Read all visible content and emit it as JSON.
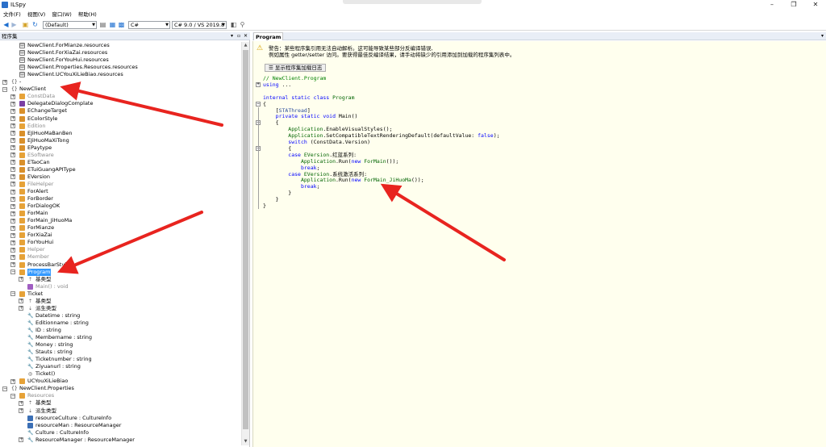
{
  "window": {
    "title": "ILSpy",
    "minimize": "–",
    "maximize": "❐",
    "close": "✕"
  },
  "menu": [
    "文件(F)",
    "视图(V)",
    "窗口(W)",
    "帮助(H)"
  ],
  "toolbar": {
    "assembly_list": "(Default)",
    "language": "C#",
    "language_version": "C# 9.0 / VS 2019.8"
  },
  "left_panel": {
    "title": "程序集",
    "pin": "▾",
    "close": "✕",
    "hide": "▫"
  },
  "tree": [
    {
      "label": "NewClient.ForMianze.resources",
      "indent": 1,
      "icon": "resource-file-icon",
      "exp": ""
    },
    {
      "label": "NewClient.ForXiaZai.resources",
      "indent": 1,
      "icon": "resource-file-icon",
      "exp": ""
    },
    {
      "label": "NewClient.ForYouHui.resources",
      "indent": 1,
      "icon": "resource-file-icon",
      "exp": ""
    },
    {
      "label": "NewClient.Properties.Resources.resources",
      "indent": 1,
      "icon": "resource-file-icon",
      "exp": ""
    },
    {
      "label": "NewClient.UCYouXiLieBiao.resources",
      "indent": 1,
      "icon": "resource-file-icon",
      "exp": ""
    },
    {
      "label": "-",
      "indent": 0,
      "icon": "namespace-icon",
      "exp": "+"
    },
    {
      "label": "NewClient",
      "indent": 0,
      "icon": "namespace-icon",
      "exp": "−"
    },
    {
      "label": "ConstData",
      "indent": 1,
      "icon": "class-icon",
      "exp": "+",
      "dim": true
    },
    {
      "label": "DelegateDialogComplate",
      "indent": 1,
      "icon": "delegate-icon",
      "exp": "+"
    },
    {
      "label": "EChangeTarget",
      "indent": 1,
      "icon": "enum-icon",
      "exp": "+"
    },
    {
      "label": "EColorStyle",
      "indent": 1,
      "icon": "enum-icon",
      "exp": "+"
    },
    {
      "label": "Edition",
      "indent": 1,
      "icon": "class-icon",
      "exp": "+",
      "dim": true
    },
    {
      "label": "EJiHuoMaBanBen",
      "indent": 1,
      "icon": "enum-icon",
      "exp": "+"
    },
    {
      "label": "EJiHuoMaXiTong",
      "indent": 1,
      "icon": "enum-icon",
      "exp": "+"
    },
    {
      "label": "EPaytype",
      "indent": 1,
      "icon": "enum-icon",
      "exp": "+"
    },
    {
      "label": "ESoftware",
      "indent": 1,
      "icon": "class-icon",
      "exp": "+",
      "dim": true
    },
    {
      "label": "ETaoCan",
      "indent": 1,
      "icon": "enum-icon",
      "exp": "+"
    },
    {
      "label": "ETuiGuangAPIType",
      "indent": 1,
      "icon": "enum-icon",
      "exp": "+"
    },
    {
      "label": "EVersion",
      "indent": 1,
      "icon": "enum-icon",
      "exp": "+"
    },
    {
      "label": "FileHelper",
      "indent": 1,
      "icon": "class-icon",
      "exp": "+",
      "dim": true
    },
    {
      "label": "ForAlert",
      "indent": 1,
      "icon": "class-icon",
      "exp": "+"
    },
    {
      "label": "ForBorder",
      "indent": 1,
      "icon": "class-icon",
      "exp": "+"
    },
    {
      "label": "ForDialogOK",
      "indent": 1,
      "icon": "class-icon",
      "exp": "+"
    },
    {
      "label": "ForMain",
      "indent": 1,
      "icon": "class-icon",
      "exp": "+"
    },
    {
      "label": "ForMain_JiHuoMa",
      "indent": 1,
      "icon": "class-icon",
      "exp": "+"
    },
    {
      "label": "ForMianze",
      "indent": 1,
      "icon": "class-icon",
      "exp": "+"
    },
    {
      "label": "ForXiaZai",
      "indent": 1,
      "icon": "class-icon",
      "exp": "+"
    },
    {
      "label": "ForYouHui",
      "indent": 1,
      "icon": "class-icon",
      "exp": "+"
    },
    {
      "label": "Helper",
      "indent": 1,
      "icon": "class-icon",
      "exp": "+",
      "dim": true
    },
    {
      "label": "Member",
      "indent": 1,
      "icon": "class-icon",
      "exp": "+",
      "dim": true
    },
    {
      "label": "ProcessBarStyle",
      "indent": 1,
      "icon": "class-icon",
      "exp": "+"
    },
    {
      "label": "Program",
      "indent": 1,
      "icon": "class-icon",
      "exp": "−",
      "selected": true
    },
    {
      "label": "基类型",
      "indent": 2,
      "icon": "base-types-icon",
      "exp": "+"
    },
    {
      "label": "Main() : void",
      "indent": 2,
      "icon": "method-icon",
      "exp": "",
      "dim": true
    },
    {
      "label": "Ticket",
      "indent": 1,
      "icon": "class-icon",
      "exp": "−"
    },
    {
      "label": "基类型",
      "indent": 2,
      "icon": "base-types-icon",
      "exp": "+"
    },
    {
      "label": "派生类型",
      "indent": 2,
      "icon": "derived-types-icon",
      "exp": "+"
    },
    {
      "label": "Datetime : string",
      "indent": 2,
      "icon": "property-icon",
      "exp": ""
    },
    {
      "label": "Editionname : string",
      "indent": 2,
      "icon": "property-icon",
      "exp": ""
    },
    {
      "label": "ID : string",
      "indent": 2,
      "icon": "property-icon",
      "exp": ""
    },
    {
      "label": "Membername : string",
      "indent": 2,
      "icon": "property-icon",
      "exp": ""
    },
    {
      "label": "Money : string",
      "indent": 2,
      "icon": "property-icon",
      "exp": ""
    },
    {
      "label": "Stauts : string",
      "indent": 2,
      "icon": "property-icon",
      "exp": ""
    },
    {
      "label": "Ticketnumber : string",
      "indent": 2,
      "icon": "property-icon",
      "exp": ""
    },
    {
      "label": "Ziyuanurl : string",
      "indent": 2,
      "icon": "property-icon",
      "exp": ""
    },
    {
      "label": "Ticket()",
      "indent": 2,
      "icon": "constructor-icon",
      "exp": ""
    },
    {
      "label": "UCYouXiLieBiao",
      "indent": 1,
      "icon": "class-icon",
      "exp": "+"
    },
    {
      "label": "NewClient.Properties",
      "indent": 0,
      "icon": "namespace-icon",
      "exp": "−"
    },
    {
      "label": "Resources",
      "indent": 1,
      "icon": "class-icon",
      "exp": "−",
      "dim": true
    },
    {
      "label": "基类型",
      "indent": 2,
      "icon": "base-types-icon",
      "exp": "+"
    },
    {
      "label": "派生类型",
      "indent": 2,
      "icon": "derived-types-icon",
      "exp": "+"
    },
    {
      "label": "resourceCulture : CultureInfo",
      "indent": 2,
      "icon": "field-icon",
      "exp": ""
    },
    {
      "label": "resourceMan : ResourceManager",
      "indent": 2,
      "icon": "field-icon",
      "exp": ""
    },
    {
      "label": "Culture : CultureInfo",
      "indent": 2,
      "icon": "property-icon",
      "exp": ""
    },
    {
      "label": "ResourceManager : ResourceManager",
      "indent": 2,
      "icon": "property-icon",
      "exp": "+"
    }
  ],
  "right_panel": {
    "tab": "Program",
    "tab_menu": "▾"
  },
  "warning": {
    "line1": "警告：某些程序集引用无法自动解析。这可能导致某些部分反编译错误,",
    "line2": "例如属性 getter/setter 访问。要获得最佳反编译结果，请手动将缺少的引用添加到加载的程序集列表中。",
    "button": "显示程序集加载日志"
  },
  "code_lines": [
    [
      {
        "t": "// NewClient.Program",
        "c": "cm"
      }
    ],
    [
      {
        "t": "using ",
        "c": "kw"
      },
      {
        "t": "...",
        "c": "mt"
      }
    ],
    [],
    [
      {
        "t": "internal static class ",
        "c": "kw"
      },
      {
        "t": "Program",
        "c": "ty"
      }
    ],
    [
      {
        "t": "{",
        "c": "mt"
      }
    ],
    [
      {
        "t": "    [",
        "c": "mt"
      },
      {
        "t": "STAThread",
        "c": "at"
      },
      {
        "t": "]",
        "c": "mt"
      }
    ],
    [
      {
        "t": "    private static void ",
        "c": "kw"
      },
      {
        "t": "Main",
        "c": "mt"
      },
      {
        "t": "()",
        "c": "mt"
      }
    ],
    [
      {
        "t": "    {",
        "c": "mt"
      }
    ],
    [
      {
        "t": "        Application",
        "c": "ty"
      },
      {
        "t": ".",
        "c": "mt"
      },
      {
        "t": "EnableVisualStyles",
        "c": "mt"
      },
      {
        "t": "();",
        "c": "mt"
      }
    ],
    [
      {
        "t": "        Application",
        "c": "ty"
      },
      {
        "t": ".",
        "c": "mt"
      },
      {
        "t": "SetCompatibleTextRenderingDefault",
        "c": "mt"
      },
      {
        "t": "(defaultValue: ",
        "c": "mt"
      },
      {
        "t": "false",
        "c": "kw"
      },
      {
        "t": ");",
        "c": "mt"
      }
    ],
    [
      {
        "t": "        switch ",
        "c": "kw"
      },
      {
        "t": "(ConstData.Version)",
        "c": "mt"
      }
    ],
    [
      {
        "t": "        {",
        "c": "mt"
      }
    ],
    [
      {
        "t": "        case ",
        "c": "kw"
      },
      {
        "t": "EVersion",
        "c": "ty"
      },
      {
        "t": ".红蓝系列:",
        "c": "mt"
      }
    ],
    [
      {
        "t": "            Application",
        "c": "ty"
      },
      {
        "t": ".Run(",
        "c": "mt"
      },
      {
        "t": "new ",
        "c": "kw"
      },
      {
        "t": "ForMain",
        "c": "ty"
      },
      {
        "t": "());",
        "c": "mt"
      }
    ],
    [
      {
        "t": "            break",
        "c": "kw"
      },
      {
        "t": ";",
        "c": "mt"
      }
    ],
    [
      {
        "t": "        case ",
        "c": "kw"
      },
      {
        "t": "EVersion",
        "c": "ty"
      },
      {
        "t": ".系统激活系列:",
        "c": "mt"
      }
    ],
    [
      {
        "t": "            Application",
        "c": "ty"
      },
      {
        "t": ".Run(",
        "c": "mt"
      },
      {
        "t": "new ",
        "c": "kw"
      },
      {
        "t": "ForMain_JiHuoMa",
        "c": "ty"
      },
      {
        "t": "());",
        "c": "mt"
      }
    ],
    [
      {
        "t": "            break",
        "c": "kw"
      },
      {
        "t": ";",
        "c": "mt"
      }
    ],
    [
      {
        "t": "        }",
        "c": "mt"
      }
    ],
    [
      {
        "t": "    }",
        "c": "mt"
      }
    ],
    [
      {
        "t": "}",
        "c": "mt"
      }
    ]
  ],
  "colors": {
    "code_bg": "#ffffee",
    "selection": "#3399ff",
    "annotation_arrow": "#e8241f"
  }
}
